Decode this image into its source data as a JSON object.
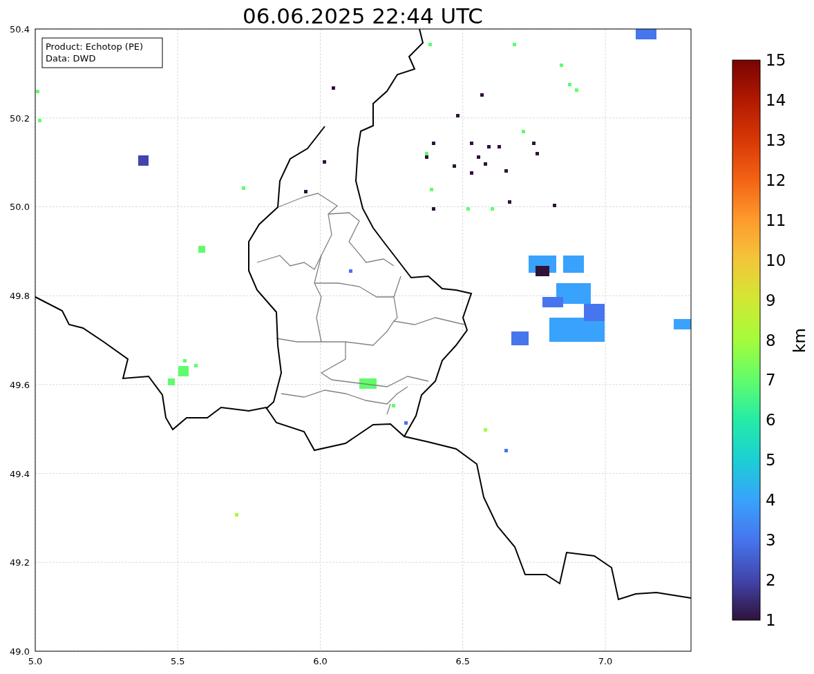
{
  "title": "06.06.2025 22:44 UTC",
  "info_box": [
    "Product: Echotop (PE)",
    "Data: DWD"
  ],
  "x_ticks": [
    "5.0",
    "5.5",
    "6.0",
    "6.5",
    "7.0"
  ],
  "y_ticks": [
    "50.4",
    "50.2",
    "50.0",
    "49.8",
    "49.6",
    "49.4",
    "49.2",
    "49.0"
  ],
  "colorbar": {
    "label": "km",
    "ticks": [
      "15",
      "14",
      "13",
      "12",
      "11",
      "10",
      "9",
      "8",
      "7",
      "6",
      "5",
      "4",
      "3",
      "2",
      "1"
    ]
  }
}
